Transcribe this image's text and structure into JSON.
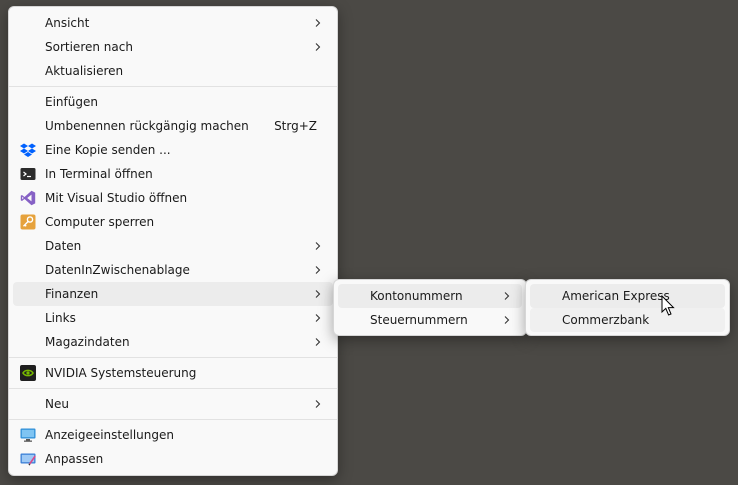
{
  "main_menu": {
    "items": [
      {
        "label": "Ansicht"
      },
      {
        "label": "Sortieren nach"
      },
      {
        "label": "Aktualisieren"
      },
      {
        "label": "Einfügen"
      },
      {
        "label": "Umbenennen rückgängig machen",
        "shortcut": "Strg+Z"
      },
      {
        "label": "Eine Kopie senden ..."
      },
      {
        "label": "In Terminal öffnen"
      },
      {
        "label": "Mit Visual Studio öffnen"
      },
      {
        "label": "Computer sperren"
      },
      {
        "label": "Daten"
      },
      {
        "label": "DatenInZwischenablage"
      },
      {
        "label": "Finanzen"
      },
      {
        "label": "Links"
      },
      {
        "label": "Magazindaten"
      },
      {
        "label": "NVIDIA Systemsteuerung"
      },
      {
        "label": "Neu"
      },
      {
        "label": "Anzeigeeinstellungen"
      },
      {
        "label": "Anpassen"
      }
    ]
  },
  "finanzen_submenu": {
    "items": [
      {
        "label": "Kontonummern"
      },
      {
        "label": "Steuernummern"
      }
    ]
  },
  "kontonummern_submenu": {
    "items": [
      {
        "label": "American Express"
      },
      {
        "label": "Commerzbank"
      }
    ]
  },
  "icons": {
    "dropbox": "dropbox-icon",
    "terminal": "terminal-icon",
    "visual_studio": "visual-studio-icon",
    "lock": "key-icon",
    "nvidia": "nvidia-icon",
    "display": "monitor-icon",
    "personalize": "personalize-icon"
  },
  "colors": {
    "desktop_background": "#4b4945",
    "menu_background": "#f9f9f9",
    "hover_background": "#ececec",
    "dropbox_blue": "#0061fe",
    "visual_studio_purple": "#8661c5",
    "nvidia_green": "#76b900"
  }
}
